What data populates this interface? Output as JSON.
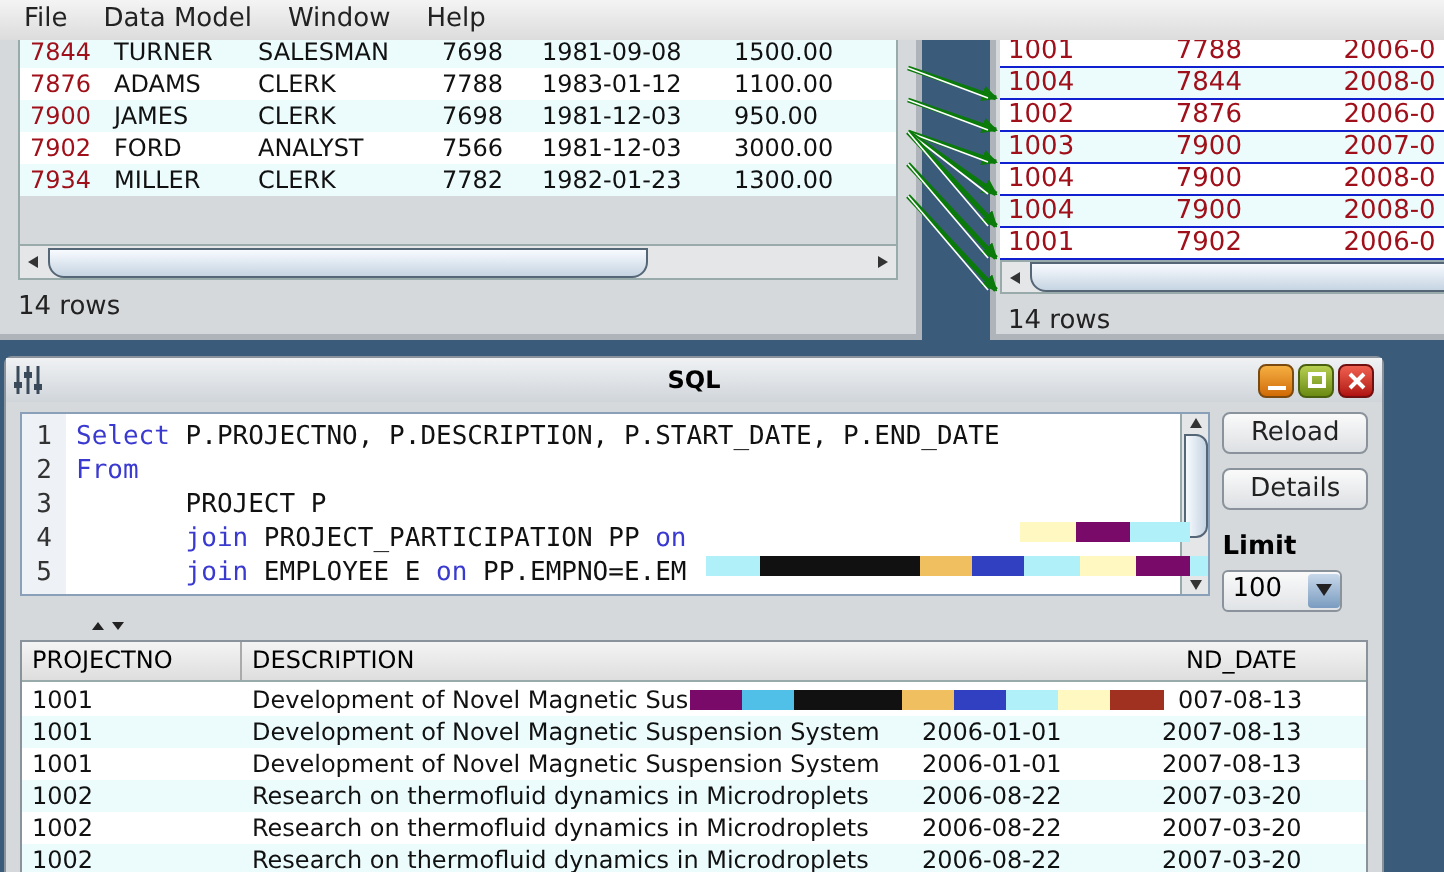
{
  "menu": [
    "File",
    "Data Model",
    "Window",
    "Help"
  ],
  "employee_table": {
    "rows": [
      {
        "cells": [
          "7844",
          "TURNER",
          "SALESMAN",
          "7698",
          "1981-09-08",
          "1500.00"
        ]
      },
      {
        "cells": [
          "7876",
          "ADAMS",
          "CLERK",
          "7788",
          "1983-01-12",
          "1100.00"
        ]
      },
      {
        "cells": [
          "7900",
          "JAMES",
          "CLERK",
          "7698",
          "1981-12-03",
          "950.00"
        ]
      },
      {
        "cells": [
          "7902",
          "FORD",
          "ANALYST",
          "7566",
          "1981-12-03",
          "3000.00"
        ]
      },
      {
        "cells": [
          "7934",
          "MILLER",
          "CLERK",
          "7782",
          "1982-01-23",
          "1300.00"
        ]
      }
    ],
    "status": "14 rows"
  },
  "participation_table": {
    "rows": [
      {
        "cells": [
          "1001",
          "7788",
          "2006-0"
        ]
      },
      {
        "cells": [
          "1004",
          "7844",
          "2008-0"
        ]
      },
      {
        "cells": [
          "1002",
          "7876",
          "2006-0"
        ]
      },
      {
        "cells": [
          "1003",
          "7900",
          "2007-0"
        ]
      },
      {
        "cells": [
          "1004",
          "7900",
          "2008-0"
        ]
      },
      {
        "cells": [
          "1004",
          "7900",
          "2008-0"
        ]
      },
      {
        "cells": [
          "1001",
          "7902",
          "2006-0"
        ]
      }
    ],
    "status": "14 rows"
  },
  "sql_window": {
    "title": "SQL",
    "lines": [
      {
        "number": "1",
        "tokens": [
          {
            "text": "Select",
            "kind": "keyword"
          },
          {
            "text": " P.PROJECTNO, P.DESCRIPTION, P.START_DATE, P.END_DATE",
            "kind": "plain"
          }
        ]
      },
      {
        "number": "2",
        "tokens": [
          {
            "text": "From",
            "kind": "keyword"
          }
        ]
      },
      {
        "number": "3",
        "tokens": [
          {
            "text": "\tPROJECT P",
            "kind": "plain"
          }
        ]
      },
      {
        "number": "4",
        "tokens": [
          {
            "text": "\tjoin",
            "kind": "keyword"
          },
          {
            "text": " PROJECT_PARTICIPATION PP ",
            "kind": "plain"
          },
          {
            "text": "on",
            "kind": "keyword"
          }
        ]
      },
      {
        "number": "5",
        "tokens": [
          {
            "text": "\tjoin",
            "kind": "keyword"
          },
          {
            "text": " EMPLOYEE E ",
            "kind": "plain"
          },
          {
            "text": "on",
            "kind": "keyword"
          },
          {
            "text": " PP.EMPNO=E.EM",
            "kind": "plain"
          }
        ]
      }
    ],
    "buttons": [
      "Reload",
      "Details"
    ],
    "limit_label": "Limit",
    "limit_value": "100"
  },
  "results": {
    "columns": [
      "PROJECTNO",
      "DESCRIPTION",
      "ND_DATE"
    ],
    "rows": [
      {
        "projectno": "1001",
        "description": "Development of Novel Magnetic Sus",
        "end_date": "007-08-13"
      },
      {
        "projectno": "1001",
        "description": "Development of Novel Magnetic Suspension System",
        "start_date": "2006-01-01",
        "end_date": "2007-08-13"
      },
      {
        "projectno": "1001",
        "description": "Development of Novel Magnetic Suspension System",
        "start_date": "2006-01-01",
        "end_date": "2007-08-13"
      },
      {
        "projectno": "1002",
        "description": "Research on thermofluid dynamics in Microdroplets",
        "start_date": "2006-08-22",
        "end_date": "2007-03-20"
      },
      {
        "projectno": "1002",
        "description": "Research on thermofluid dynamics in Microdroplets",
        "start_date": "2006-08-22",
        "end_date": "2007-03-20"
      },
      {
        "projectno": "1002",
        "description": "Research on thermofluid dynamics in Microdroplets",
        "start_date": "2006-08-22",
        "end_date": "2007-03-20"
      }
    ]
  }
}
